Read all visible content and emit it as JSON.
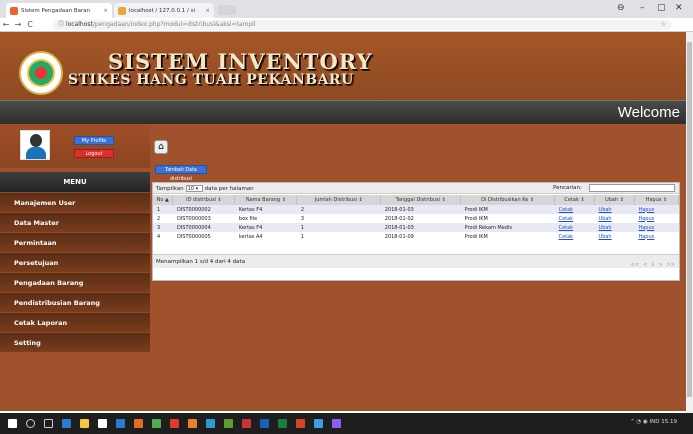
{
  "browser": {
    "tabs": [
      {
        "title": "Sistem Pengadaan Baran",
        "close": "×"
      },
      {
        "title": "localhost / 127.0.0.1 / si",
        "close": "×"
      }
    ],
    "address_host": "localhost",
    "address_path": "/pengadaan/index.php?modul=distribusi&aksi=tampil",
    "win_min": "–",
    "win_max": "▢",
    "win_close": "✕",
    "back": "←",
    "forward": "→",
    "reload": "C",
    "info": "ⓘ",
    "star": "☆"
  },
  "header": {
    "title": "SISTEM INVENTORY",
    "subtitle": "STIKES HANG TUAH PEKANBARU",
    "welcome": "Welcome"
  },
  "sidebar": {
    "my_profile": "My Profile",
    "logout": "Logout",
    "menu_title": "MENU",
    "items": [
      {
        "label": "Manajemen User"
      },
      {
        "label": "Data Master"
      },
      {
        "label": "Permintaan"
      },
      {
        "label": "Persetujuan"
      },
      {
        "label": "Pengadaan Barang"
      },
      {
        "label": "Pendistribusian Barang"
      },
      {
        "label": "Cetak Laporan"
      },
      {
        "label": "Setting"
      }
    ]
  },
  "content": {
    "add_button": "Tambah Data distribusi",
    "show_prefix": "Tampilkan",
    "show_value": "10",
    "show_suffix": "data per halaman",
    "search_label": "Pencarian:",
    "columns": [
      "No",
      "ID distribusi",
      "Nama Barang",
      "Jumlah Distribusi",
      "Tanggal Distribusi",
      "Di Distribusikan Ke",
      "Cetak",
      "Ubah",
      "Hapus"
    ],
    "rows": [
      {
        "no": "1",
        "id": "DIST0000002",
        "nama": "Kertas F4",
        "jumlah": "2",
        "tanggal": "2018-01-03",
        "tujuan": "Prodi IKM",
        "cetak": "Cetak",
        "ubah": "Ubah",
        "hapus": "Hapus"
      },
      {
        "no": "2",
        "id": "DIST0000003",
        "nama": "box file",
        "jumlah": "3",
        "tanggal": "2018-01-02",
        "tujuan": "Prodi IKM",
        "cetak": "Cetak",
        "ubah": "Ubah",
        "hapus": "Hapus"
      },
      {
        "no": "3",
        "id": "DIST0000004",
        "nama": "Kertas F4",
        "jumlah": "1",
        "tanggal": "2018-01-03",
        "tujuan": "Prodi Rekam Medis",
        "cetak": "Cetak",
        "ubah": "Ubah",
        "hapus": "Hapus"
      },
      {
        "no": "4",
        "id": "DIST0000005",
        "nama": "kertas A4",
        "jumlah": "1",
        "tanggal": "2018-01-09",
        "tujuan": "Prodi IKM",
        "cetak": "Cetak",
        "ubah": "Ubah",
        "hapus": "Hapus"
      }
    ],
    "footer": "Menampilkan 1 s/d 4 dari 4 data",
    "pager": [
      "<<",
      "<",
      "1",
      ">",
      ">>"
    ]
  },
  "taskbar": {
    "tray_lang": "IND",
    "tray_time": "15.19"
  },
  "colors": {
    "brand_bg": "#a0522d",
    "button_blue": "#3a73d8",
    "button_red": "#d82f2f",
    "link": "#1a4fd8"
  }
}
